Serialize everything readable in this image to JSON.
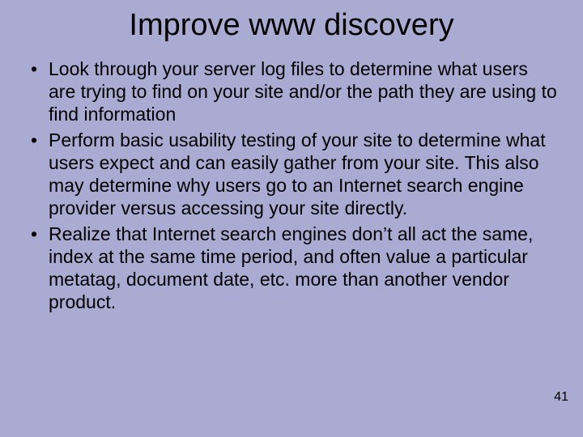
{
  "title": "Improve www discovery",
  "bullets": [
    "Look through your server log files to determine what users are trying to find on your site and/or the path they are using to find information",
    "Perform basic usability testing of your site to determine what users expect and can easily gather from your site. This also may determine why users go to an Internet search engine provider versus accessing your site directly.",
    "Realize that Internet search engines don’t all act the same, index at the same time period, and often value a particular metatag, document date, etc. more than another vendor product."
  ],
  "page_number": "41"
}
